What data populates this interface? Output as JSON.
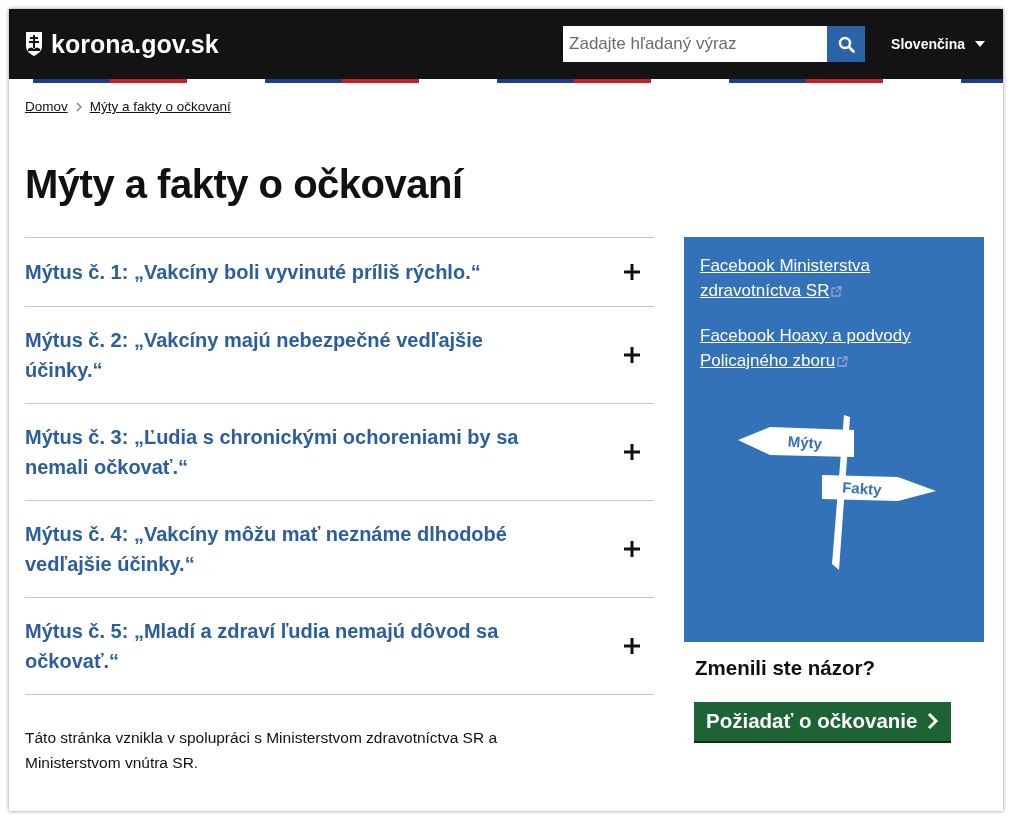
{
  "header": {
    "logo": "korona.gov.sk",
    "search": {
      "placeholder": "Zadajte hľadaný výraz"
    },
    "language": "Slovenčina"
  },
  "breadcrumb": [
    "Domov",
    "Mýty a fakty o očkovaní"
  ],
  "title": "Mýty a fakty o očkovaní",
  "accordion": [
    {
      "title": "Mýtus č. 1: „Vakcíny boli vyvinuté príliš rýchlo.“",
      "expanded": false
    },
    {
      "title": "Mýtus č. 2: „Vakcíny majú nebezpečné vedľajšie účinky.“",
      "expanded": false
    },
    {
      "title": "Mýtus č. 3: „Ľudia s chronickými ochoreniami by sa nemali očkovať.“",
      "expanded": false
    },
    {
      "title": "Mýtus č. 4: „Vakcíny môžu mať neznáme dlhodobé vedľajšie účinky.“",
      "expanded": false
    },
    {
      "title": "Mýtus č. 5: „Mladí a zdraví ľudia nemajú dôvod sa očkovať.“",
      "expanded": false
    }
  ],
  "footnote": "Táto stránka vznikla v spolupráci s Ministerstvom zdravotníctva SR a Ministerstvom vnútra SR.",
  "sidebar": {
    "links": [
      "Facebook Ministerstva zdravotníctva SR",
      "Facebook Hoaxy a podvody Policajného zboru"
    ],
    "signpost": {
      "left_sign": "Mýty",
      "right_sign": "Fakty"
    },
    "question": "Zmenili ste názor?",
    "button": "Požiadať o očkovanie"
  }
}
